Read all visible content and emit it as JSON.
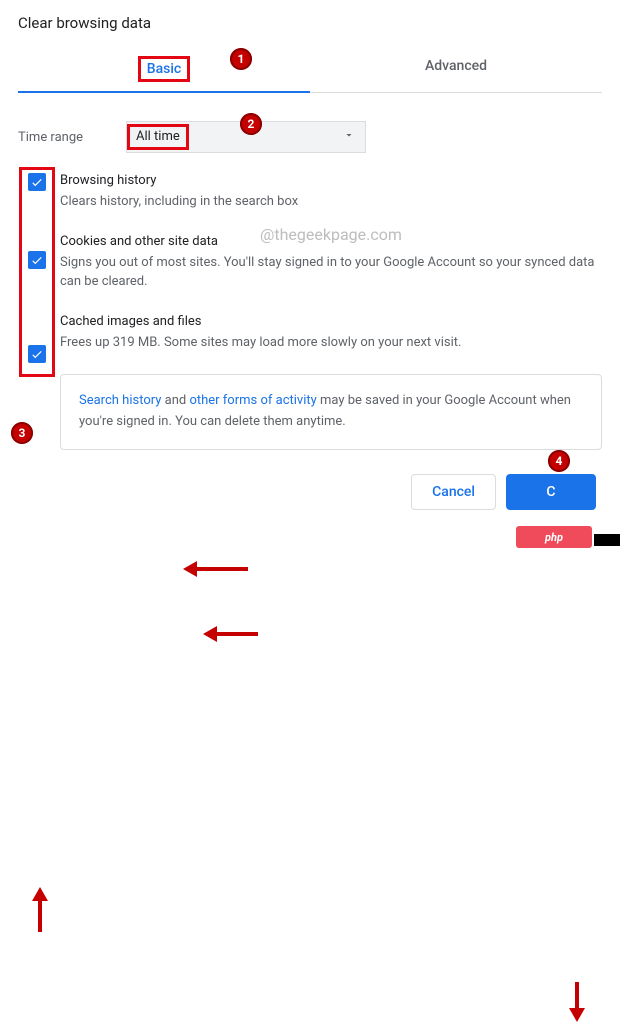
{
  "title": "Clear browsing data",
  "tabs": {
    "basic": "Basic",
    "advanced": "Advanced"
  },
  "time_range": {
    "label": "Time range",
    "value": "All time"
  },
  "items": [
    {
      "title": "Browsing history",
      "desc": "Clears history, including in the search box"
    },
    {
      "title": "Cookies and other site data",
      "desc": "Signs you out of most sites. You'll stay signed in to your Google Account so your synced data can be cleared."
    },
    {
      "title": "Cached images and files",
      "desc": "Frees up 319 MB. Some sites may load more slowly on your next visit."
    }
  ],
  "info": {
    "link1": "Search history",
    "mid1": " and ",
    "link2": "other forms of activity",
    "rest": " may be saved in your Google Account when you're signed in. You can delete them anytime."
  },
  "buttons": {
    "cancel": "Cancel",
    "clear": "C"
  },
  "watermark": "@thegeekpage.com",
  "overlay": "php",
  "callouts": {
    "c1": "1",
    "c2": "2",
    "c3": "3",
    "c4": "4"
  }
}
